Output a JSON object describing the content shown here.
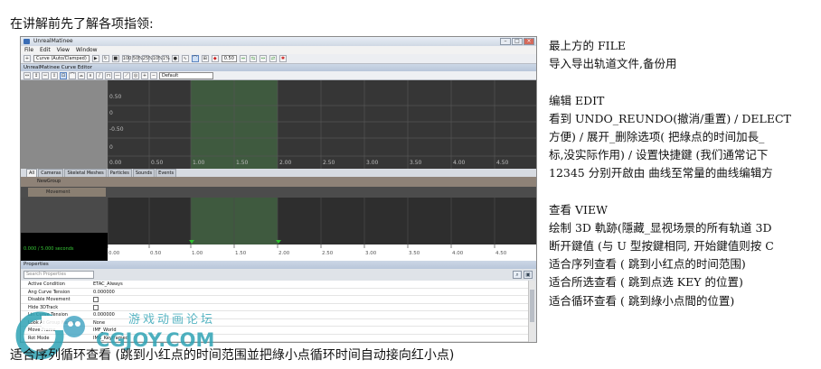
{
  "intro_text": "在讲解前先了解各项指领:",
  "bottom_text": "适合序列循环查看 (跳到小红点的时间范围並把綠小点循环时间自动接向红小点)",
  "notes": [
    "最上方的 FILE",
    "导入导出轨道文件,备份用",
    "",
    "编辑 EDIT",
    "看到 UNDO_REUNDO(撤消/重置) / DELECT",
    "方便) / 展开_删除选项( 把綠点的时间加長_",
    "标,没实际作用) / 设置快捷鍵 (我们通常记下",
    "12345 分别开啟由 曲线至常量的曲线编辑方",
    "",
    "查看 VIEW",
    "绘制 3D 軌跡(隱藏_显视场景的所有轨道 3D",
    "断开鍵值 (与 U 型按鍵相同, 开始鍵值则按 C",
    "适合序列查看 ( 跳到小红点的时间范围)",
    "适合所选查看 ( 跳到点选 KEY 的位置)",
    "适合循环查看 ( 跳到綠小点間的位置)"
  ],
  "window": {
    "title": "UnrealMatinee",
    "menu": [
      "File",
      "Edit",
      "View",
      "Window"
    ],
    "interp_mode": "Curve (Auto/Clamped)",
    "speed_buttons": [
      "100",
      "50%",
      "25%",
      "10%",
      "1%"
    ],
    "snap_value": "0.50",
    "curve_editor_title": "UnrealMatinee Curve Editor",
    "curve_preset": "Default",
    "curve_y_labels": [
      "0.50",
      "0",
      "-0.50",
      "0"
    ],
    "curve_x_labels": [
      "0.00",
      "0.50",
      "1.00",
      "1.50",
      "2.00",
      "2.50",
      "3.00",
      "3.50",
      "4.00",
      "4.50"
    ],
    "tabs": [
      "All",
      "Cameras",
      "Skeletal Meshes",
      "Particles",
      "Sounds",
      "Events"
    ],
    "group_name": "NewGroup",
    "track_name": "Movement",
    "track_x_labels": [
      "0.00",
      "0.50",
      "1.00",
      "1.50",
      "2.00",
      "2.50",
      "3.00",
      "3.50",
      "4.00",
      "4.50"
    ],
    "seq_status": "0.000 / 5.000 seconds",
    "properties_title": "Properties",
    "search_placeholder": "Search Properties",
    "properties": [
      {
        "name": "Active Condition",
        "value": "ETAC_Always",
        "check": false
      },
      {
        "name": "Ang Curve Tension",
        "value": "0.000000",
        "check": false
      },
      {
        "name": "Disable Movement",
        "value": "",
        "check": true
      },
      {
        "name": "Hide 3DTrack",
        "value": "",
        "check": true
      },
      {
        "name": "Lin Curve Tension",
        "value": "0.000000",
        "check": false
      },
      {
        "name": "Look At Group Name",
        "value": "None",
        "check": false
      },
      {
        "name": "Move Frame",
        "value": "IMF_World",
        "check": false
      },
      {
        "name": "Rot Mode",
        "value": "IMR_Keyframed",
        "check": false
      }
    ]
  },
  "watermark": {
    "site_cn": "游戏动画论坛",
    "brand": "CGJOY.COM"
  },
  "colors": {
    "graph_bg": "#363636",
    "loop_region": "#3f5a3f",
    "group_row": "#8e8277",
    "status_green": "#37c837",
    "watermark_teal": "#2fa3b5"
  }
}
